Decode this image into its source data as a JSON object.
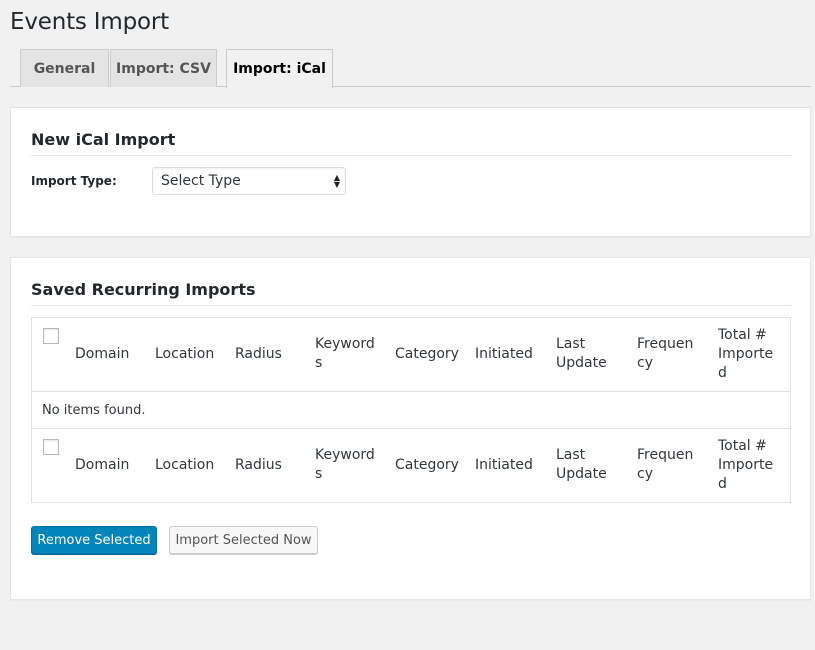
{
  "page": {
    "title": "Events Import"
  },
  "tabs": [
    {
      "label": "General",
      "active": false
    },
    {
      "label": "Import: CSV",
      "active": false
    },
    {
      "label": "Import: iCal",
      "active": true
    }
  ],
  "new_import": {
    "title": "New iCal Import",
    "import_type_label": "Import Type:",
    "import_type_value": "Select Type"
  },
  "saved_imports": {
    "title": "Saved Recurring Imports",
    "columns": [
      {
        "line1": "Domain",
        "line2": "",
        "line3": ""
      },
      {
        "line1": "Location",
        "line2": "",
        "line3": ""
      },
      {
        "line1": "Radius",
        "line2": "",
        "line3": ""
      },
      {
        "line1": "Keyword",
        "line2": "s",
        "line3": ""
      },
      {
        "line1": "Category",
        "line2": "",
        "line3": ""
      },
      {
        "line1": "Initiated",
        "line2": "",
        "line3": ""
      },
      {
        "line1": "Last",
        "line2": "Update",
        "line3": ""
      },
      {
        "line1": "Frequen",
        "line2": "cy",
        "line3": ""
      },
      {
        "line1": "Total #",
        "line2": "Importe",
        "line3": "d"
      }
    ],
    "empty_message": "No items found.",
    "remove_button": "Remove Selected",
    "import_now_button": "Import Selected Now"
  },
  "colors": {
    "primary": "#0085ba",
    "background": "#f1f1f1",
    "panel": "#ffffff"
  },
  "icons": {
    "select_arrows": "up-down-arrows-icon"
  }
}
